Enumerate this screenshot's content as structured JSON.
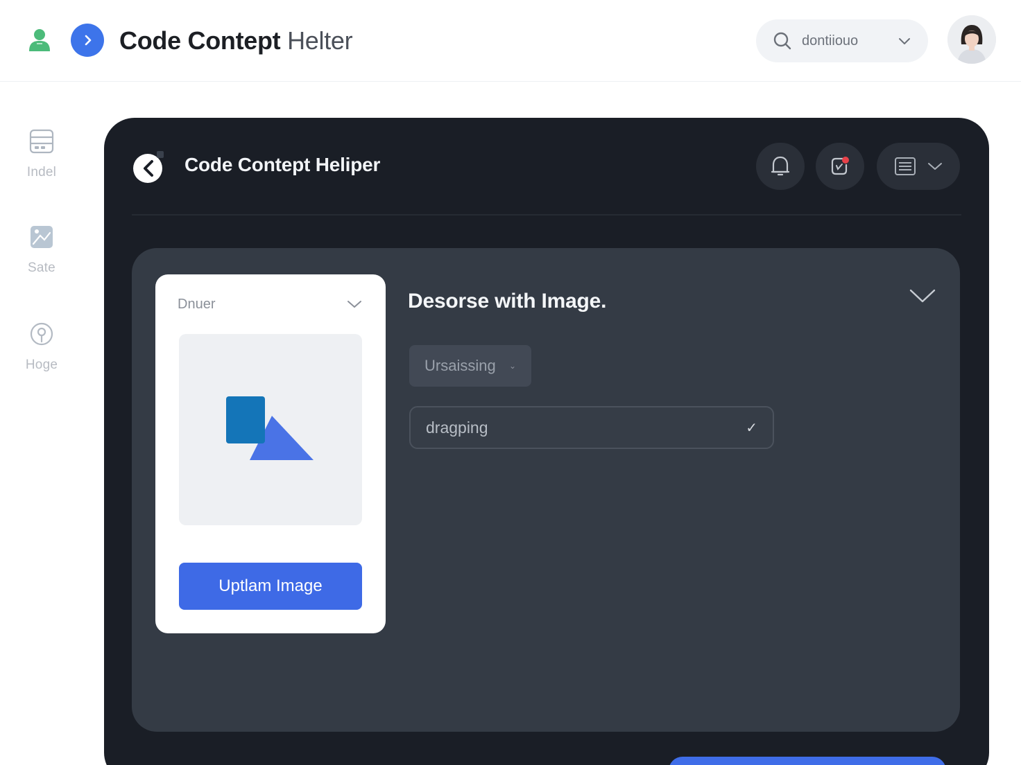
{
  "header": {
    "title_main": "Code Contept",
    "title_secondary": "Helter",
    "search": {
      "value": "dontiiouo"
    }
  },
  "sidebar": {
    "items": [
      {
        "label": "Indel",
        "icon": "database-icon"
      },
      {
        "label": "Sate",
        "icon": "image-edit-icon"
      },
      {
        "label": "Hoge",
        "icon": "location-icon"
      }
    ]
  },
  "panel": {
    "title": "Code Contept Heliper",
    "actions": [
      "bell-icon",
      "notification-icon",
      "list-icon"
    ]
  },
  "upload": {
    "select_label": "Dnuer",
    "button_label": "Uptlam Image"
  },
  "form": {
    "section_title": "Desorse with Image.",
    "chip_label": "Ursaissing",
    "chip_caret": "⌄",
    "field_value": "dragping",
    "field_check": "✓"
  },
  "colors": {
    "accent": "#3e6ae6",
    "panel_bg": "#1a1e26",
    "inner_bg": "#343b45",
    "brand_green": "#4cbb7a"
  }
}
